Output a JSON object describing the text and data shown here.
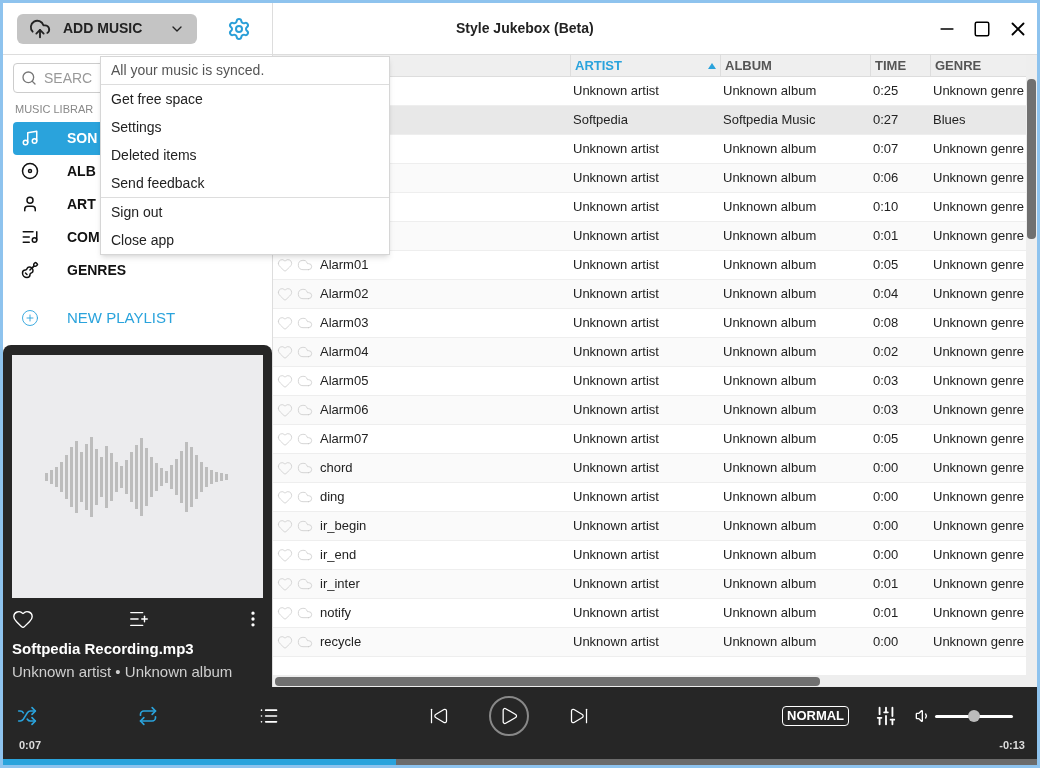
{
  "window": {
    "title": "Style Jukebox (Beta)"
  },
  "add_music": {
    "label": "ADD MUSIC"
  },
  "search": {
    "placeholder": "SEARC"
  },
  "sidebar": {
    "section": "MUSIC LIBRAR",
    "new_playlist": "NEW PLAYLIST",
    "items": [
      {
        "label": "SON",
        "kind": "songs",
        "selected": true
      },
      {
        "label": "ALB",
        "kind": "albums",
        "selected": false
      },
      {
        "label": "ART",
        "kind": "artists",
        "selected": false
      },
      {
        "label": "COM",
        "kind": "composers",
        "selected": false
      },
      {
        "label": "GENRES",
        "kind": "genres",
        "selected": false
      }
    ]
  },
  "menu": {
    "status": "All your music is synced.",
    "groups": [
      [
        {
          "label": "Get free space"
        },
        {
          "label": "Settings"
        },
        {
          "label": "Deleted items"
        },
        {
          "label": "Send feedback"
        }
      ],
      [
        {
          "label": "Sign out"
        },
        {
          "label": "Close app"
        }
      ]
    ]
  },
  "table": {
    "columns": [
      {
        "label": "ARTIST",
        "sorted": true
      },
      {
        "label": "ALBUM",
        "sorted": false
      },
      {
        "label": "TIME",
        "sorted": false
      },
      {
        "label": "GENRE",
        "sorted": false
      }
    ],
    "rows": [
      {
        "artist": "Unknown artist",
        "album": "Unknown album",
        "time": "0:25",
        "genre": "Unknown genre",
        "selected": false
      },
      {
        "artist": "Softpedia",
        "album": "Softpedia Music",
        "time": "0:27",
        "genre": "Blues",
        "selected": true
      },
      {
        "artist": "Unknown artist",
        "album": "Unknown album",
        "time": "0:07",
        "genre": "Unknown genre",
        "selected": false
      },
      {
        "artist": "Unknown artist",
        "album": "Unknown album",
        "time": "0:06",
        "genre": "Unknown genre",
        "selected": false
      },
      {
        "artist": "Unknown artist",
        "album": "Unknown album",
        "time": "0:10",
        "genre": "Unknown genre",
        "selected": false
      },
      {
        "artist": "Unknown artist",
        "album": "Unknown album",
        "time": "0:01",
        "genre": "Unknown genre",
        "selected": false
      },
      {
        "title": "Alarm01",
        "artist": "Unknown artist",
        "album": "Unknown album",
        "time": "0:05",
        "genre": "Unknown genre",
        "selected": false
      },
      {
        "title": "Alarm02",
        "artist": "Unknown artist",
        "album": "Unknown album",
        "time": "0:04",
        "genre": "Unknown genre",
        "selected": false
      },
      {
        "title": "Alarm03",
        "artist": "Unknown artist",
        "album": "Unknown album",
        "time": "0:08",
        "genre": "Unknown genre",
        "selected": false
      },
      {
        "title": "Alarm04",
        "artist": "Unknown artist",
        "album": "Unknown album",
        "time": "0:02",
        "genre": "Unknown genre",
        "selected": false
      },
      {
        "title": "Alarm05",
        "artist": "Unknown artist",
        "album": "Unknown album",
        "time": "0:03",
        "genre": "Unknown genre",
        "selected": false
      },
      {
        "title": "Alarm06",
        "artist": "Unknown artist",
        "album": "Unknown album",
        "time": "0:03",
        "genre": "Unknown genre",
        "selected": false
      },
      {
        "title": "Alarm07",
        "artist": "Unknown artist",
        "album": "Unknown album",
        "time": "0:05",
        "genre": "Unknown genre",
        "selected": false
      },
      {
        "title": "chord",
        "artist": "Unknown artist",
        "album": "Unknown album",
        "time": "0:00",
        "genre": "Unknown genre",
        "selected": false
      },
      {
        "title": "ding",
        "artist": "Unknown artist",
        "album": "Unknown album",
        "time": "0:00",
        "genre": "Unknown genre",
        "selected": false
      },
      {
        "title": "ir_begin",
        "artist": "Unknown artist",
        "album": "Unknown album",
        "time": "0:00",
        "genre": "Unknown genre",
        "selected": false
      },
      {
        "title": "ir_end",
        "artist": "Unknown artist",
        "album": "Unknown album",
        "time": "0:00",
        "genre": "Unknown genre",
        "selected": false
      },
      {
        "title": "ir_inter",
        "artist": "Unknown artist",
        "album": "Unknown album",
        "time": "0:01",
        "genre": "Unknown genre",
        "selected": false
      },
      {
        "title": "notify",
        "artist": "Unknown artist",
        "album": "Unknown album",
        "time": "0:01",
        "genre": "Unknown genre",
        "selected": false
      },
      {
        "title": "recycle",
        "artist": "Unknown artist",
        "album": "Unknown album",
        "time": "0:00",
        "genre": "Unknown genre",
        "selected": false
      }
    ]
  },
  "now_playing": {
    "title": "Softpedia Recording.mp3",
    "subtitle": "Unknown artist • Unknown album"
  },
  "player": {
    "shuffle": true,
    "repeat": true,
    "mode": "NORMAL",
    "elapsed": "0:07",
    "remaining": "-0:13",
    "progress": {
      "level": 0.38
    },
    "volume": {
      "level": 0.5
    }
  }
}
